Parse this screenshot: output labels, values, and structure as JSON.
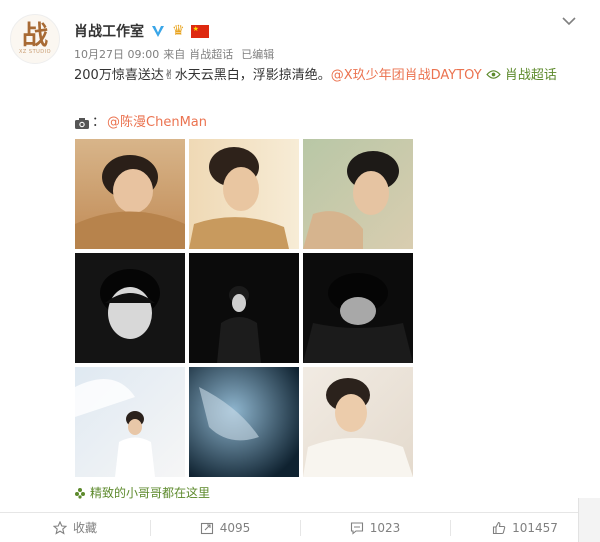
{
  "user": {
    "avatar_text": "战",
    "avatar_sub": "XZ STUDIO",
    "name": "肖战工作室",
    "verified_icon": "verified-v-icon",
    "crown_icon": "crown-icon",
    "flag_icon": "china-flag-icon"
  },
  "meta": {
    "time": "10月27日 09:00",
    "source_prefix": "来自",
    "source": "肖战超话",
    "edited": "已编辑"
  },
  "post": {
    "text_main": "200万惊喜送达✌水天云黑白，浮影掠清绝。",
    "mention": "@X玖少年团肖战DAYTOY",
    "supertopic_icon": "supertopic-icon",
    "supertopic": "肖战超话",
    "camera_icon": "camera-icon",
    "camera_sep": "：",
    "photographer": "@陈漫ChenMan"
  },
  "album": {
    "icon": "album-icon",
    "label": "精致的小哥哥都在这里"
  },
  "actions": {
    "favorite_label": "收藏",
    "repost_count": "4095",
    "comment_count": "1023",
    "like_count": "101457"
  },
  "colors": {
    "accent_orange": "#eb7350",
    "topic_green": "#5d8a2c",
    "meta_gray": "#808080"
  }
}
